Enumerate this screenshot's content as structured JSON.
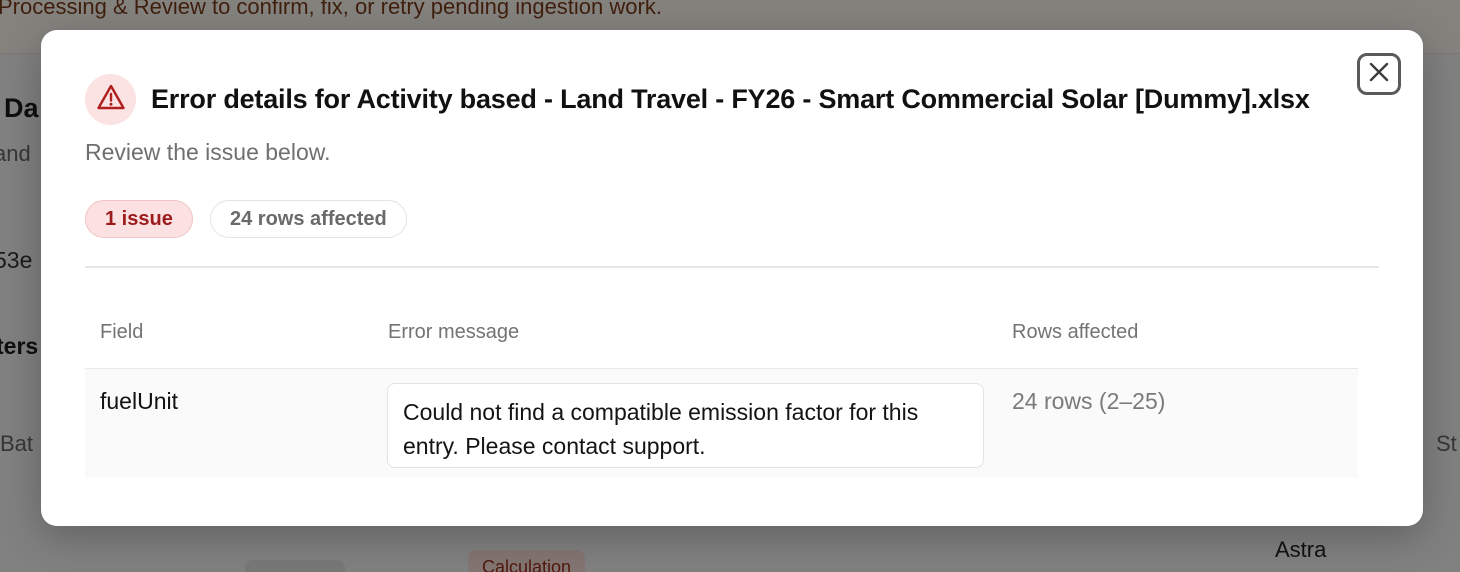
{
  "background": {
    "banner_text": "Processing & Review to confirm, fix, or retry pending ingestion work.",
    "page_title_fragment": "Da",
    "page_subtitle_fragment": "and",
    "id_fragment": "53e",
    "filters_fragment": "ters",
    "column_fragment_left": "Bat",
    "column_fragment_right": "St",
    "row_value_fragment": "Astra",
    "chip_fragment": "Calculation"
  },
  "modal": {
    "title": "Error details for Activity based - Land Travel - FY26 - Smart Commercial Solar [Dummy].xlsx",
    "subtitle": "Review the issue below.",
    "issue_count_label": "1 issue",
    "rows_affected_label": "24 rows affected",
    "close_icon": "close-icon",
    "warning_icon": "warning-triangle-icon",
    "accent_color": "#9b1c1c",
    "table": {
      "headers": {
        "field": "Field",
        "message": "Error message",
        "rows": "Rows affected"
      },
      "rows": [
        {
          "field": "fuelUnit",
          "message": "Could not find a compatible emission factor for this entry. Please contact support.",
          "rows": "24 rows (2–25)"
        }
      ]
    }
  }
}
